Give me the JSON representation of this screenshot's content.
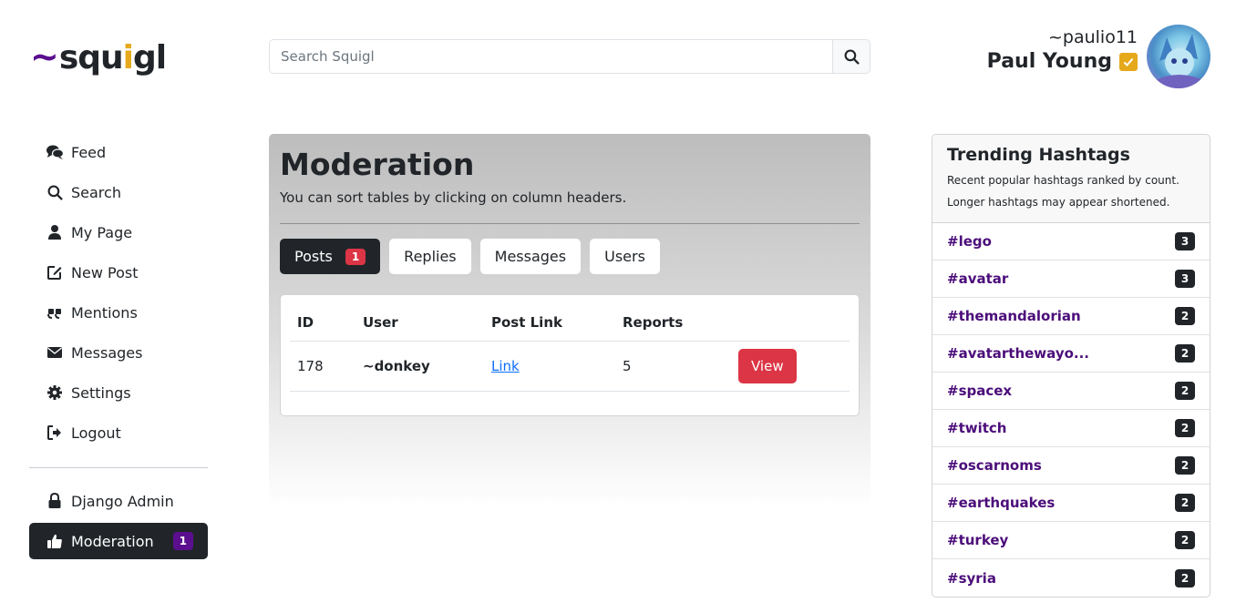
{
  "brand": {
    "tilde": "~",
    "name_a": "squ",
    "name_i": "i",
    "name_b": "gl"
  },
  "search": {
    "placeholder": "Search Squigl"
  },
  "user": {
    "username": "~paulio11",
    "fullname": "Paul Young"
  },
  "sidebar": {
    "items": [
      {
        "label": "Feed",
        "icon": "comments-icon"
      },
      {
        "label": "Search",
        "icon": "search-icon"
      },
      {
        "label": "My Page",
        "icon": "user-icon"
      },
      {
        "label": "New Post",
        "icon": "edit-icon"
      },
      {
        "label": "Mentions",
        "icon": "quote-icon"
      },
      {
        "label": "Messages",
        "icon": "envelope-icon"
      },
      {
        "label": "Settings",
        "icon": "gear-icon"
      },
      {
        "label": "Logout",
        "icon": "logout-icon"
      }
    ],
    "admin_label": "Django Admin",
    "moderation_label": "Moderation",
    "moderation_badge": "1"
  },
  "main": {
    "title": "Moderation",
    "subtitle": "You can sort tables by clicking on column headers.",
    "tabs": [
      {
        "label": "Posts",
        "badge": "1"
      },
      {
        "label": "Replies"
      },
      {
        "label": "Messages"
      },
      {
        "label": "Users"
      }
    ],
    "table": {
      "headers": [
        "ID",
        "User",
        "Post Link",
        "Reports",
        ""
      ],
      "rows": [
        {
          "id": "178",
          "user": "~donkey",
          "link": "Link",
          "reports": "5",
          "action": "View"
        }
      ]
    }
  },
  "trending": {
    "title": "Trending Hashtags",
    "desc1": "Recent popular hashtags ranked by count.",
    "desc2": "Longer hashtags may appear shortened.",
    "tags": [
      {
        "tag": "#lego",
        "count": "3"
      },
      {
        "tag": "#avatar",
        "count": "3"
      },
      {
        "tag": "#themandalorian",
        "count": "2"
      },
      {
        "tag": "#avatarthewayo...",
        "count": "2"
      },
      {
        "tag": "#spacex",
        "count": "2"
      },
      {
        "tag": "#twitch",
        "count": "2"
      },
      {
        "tag": "#oscarnoms",
        "count": "2"
      },
      {
        "tag": "#earthquakes",
        "count": "2"
      },
      {
        "tag": "#turkey",
        "count": "2"
      },
      {
        "tag": "#syria",
        "count": "2"
      }
    ]
  },
  "colors": {
    "brand_purple": "#5b0f8f",
    "brand_gold": "#e5a91b",
    "danger": "#dc3545",
    "dark": "#212529"
  }
}
